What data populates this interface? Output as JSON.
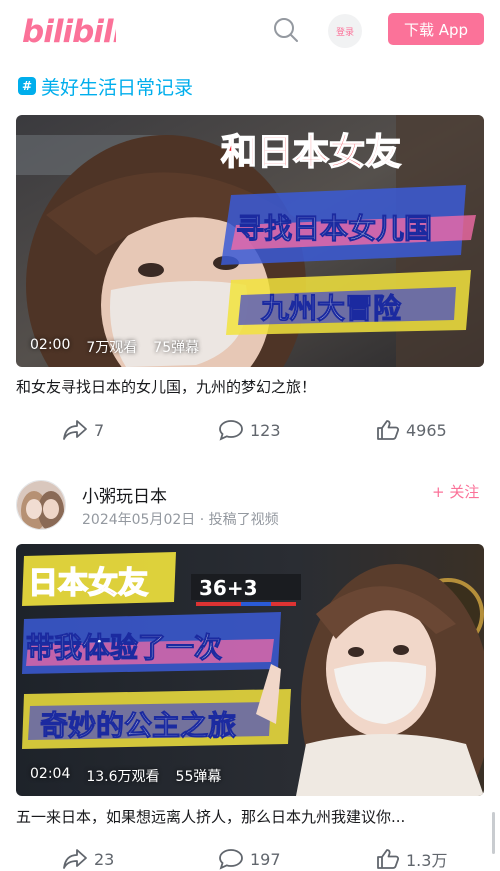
{
  "header": {
    "logo_text": "bilibili",
    "login_label": "登录",
    "download_label": "下载 App",
    "brand_color": "#fb7299"
  },
  "topic": {
    "icon_glyph": "#",
    "label": "美好生活日常记录",
    "color": "#00aeec"
  },
  "videos": [
    {
      "overlay_lines": [
        "和日本女友",
        "寻找日本女儿国",
        "九州大冒险"
      ],
      "duration": "02:00",
      "views": "7万观看",
      "danmaku": "75弹幕",
      "description": "和女友寻找日本的女儿国，九州的梦幻之旅！",
      "shares": "7",
      "comments": "123",
      "likes": "4965"
    },
    {
      "overlay_lines": [
        "日本女友",
        "带我体验了一次",
        "奇妙的公主之旅"
      ],
      "sign_text": "36+3",
      "duration": "02:04",
      "views": "13.6万观看",
      "danmaku": "55弹幕",
      "description": "五一来日本，如果想远离人挤人，那么日本九州我建议你...",
      "shares": "23",
      "comments": "197",
      "likes": "1.3万"
    }
  ],
  "author": {
    "name": "小粥玩日本",
    "date": "2024年05月02日",
    "action": "· 投稿了视频",
    "follow_label": "+ 关注"
  }
}
